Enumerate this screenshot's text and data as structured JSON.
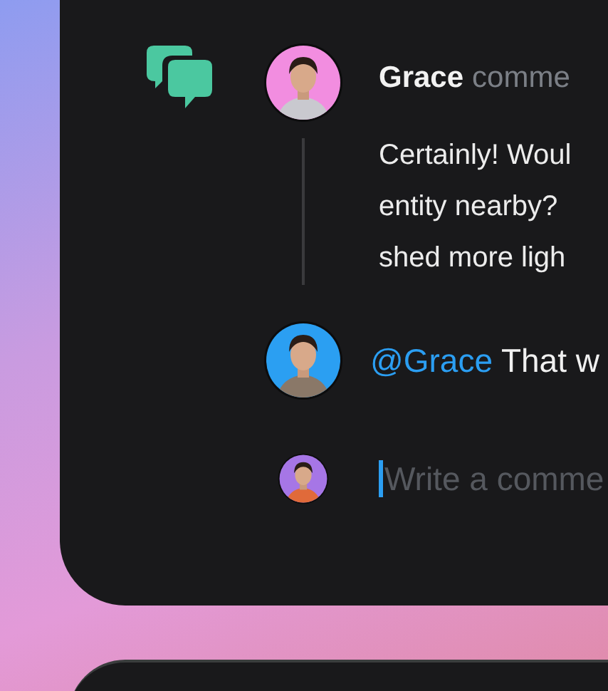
{
  "comments": [
    {
      "author": "Grace",
      "action": "comme",
      "body": "Certainly! Woul\nentity nearby?\nshed more ligh"
    }
  ],
  "replies": [
    {
      "mention": "@Grace",
      "text": "That w"
    }
  ],
  "composer": {
    "placeholder": "Write a comme",
    "focused": true
  }
}
